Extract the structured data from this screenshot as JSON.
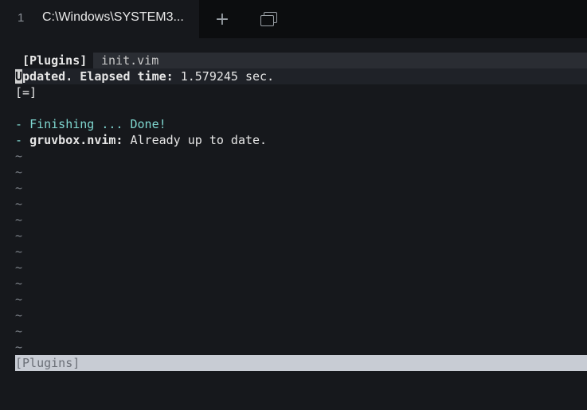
{
  "tab": {
    "index": "1",
    "title": "C:\\Windows\\SYSTEM3..."
  },
  "toolbar": {
    "plus": "+"
  },
  "vim": {
    "tabline": {
      "active": "[Plugins]",
      "other": "init.vim"
    },
    "updated_first_char": "U",
    "updated_rest": "pdated. Elapsed time:",
    "elapsed": " 1.579245 sec.",
    "progress": "[=]",
    "lines": [
      {
        "dash": "- ",
        "text": "Finishing ... Done!"
      },
      {
        "dash": "- ",
        "name": "gruvbox.nvim:",
        "msg": " Already up to date."
      }
    ],
    "tilde": "~",
    "statusline": "[Plugins]"
  },
  "colors": {
    "accent_cyan": "#7fd7d0",
    "background": "#16181c",
    "statusline": "#c8ccd4"
  }
}
